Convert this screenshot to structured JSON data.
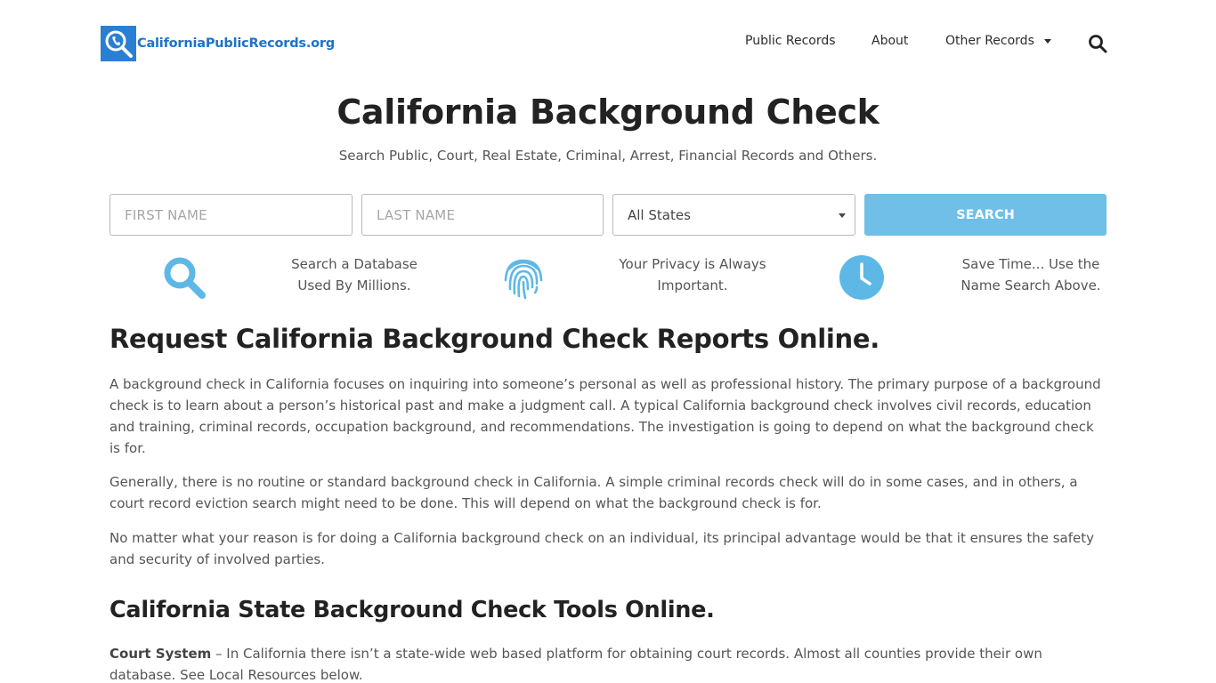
{
  "header": {
    "logo_text": "CaliforniaPublicRecords.org",
    "nav": {
      "public_records": "Public Records",
      "about": "About",
      "other_records": "Other Records"
    }
  },
  "hero": {
    "title": "California Background Check",
    "subtitle": "Search Public, Court, Real Estate, Criminal, Arrest, Financial Records and Others."
  },
  "search": {
    "first_name_placeholder": "FIRST NAME",
    "last_name_placeholder": "LAST NAME",
    "state_selected": "All States",
    "button_label": "SEARCH"
  },
  "features": {
    "f1_line1": "Search a Database",
    "f1_line2": "Used By Millions.",
    "f2_line1": "Your Privacy is Always",
    "f2_line2": "Important.",
    "f3_line1": "Save Time... Use the",
    "f3_line2": "Name Search Above."
  },
  "content": {
    "heading1": "Request California Background Check Reports Online.",
    "para1": "A background check in California focuses on inquiring into someone’s personal as well as professional history. The primary purpose of a background check is to learn about a person’s historical past and make a judgment call. A typical California background check involves civil records, education and training, criminal records, occupation background, and recommendations. The investigation is going to depend on what the background check is for.",
    "para2": "Generally, there is no routine or standard background check in California. A simple criminal records check will do in some cases, and in others, a court record eviction search might need to be done. This will depend on what the background check is for.",
    "para3": "No matter what your reason is for doing a California background check on an individual, its principal advantage would be that it ensures the safety and security of involved parties.",
    "heading2": "California State Background Check Tools Online.",
    "court_label": "Court System",
    "court_text": " – In California there isn’t a state-wide web based platform for obtaining court records. Almost all counties provide their own database. See Local Resources below."
  },
  "colors": {
    "brand_blue": "#2a7fd4",
    "accent_light_blue": "#6fbfe8"
  }
}
